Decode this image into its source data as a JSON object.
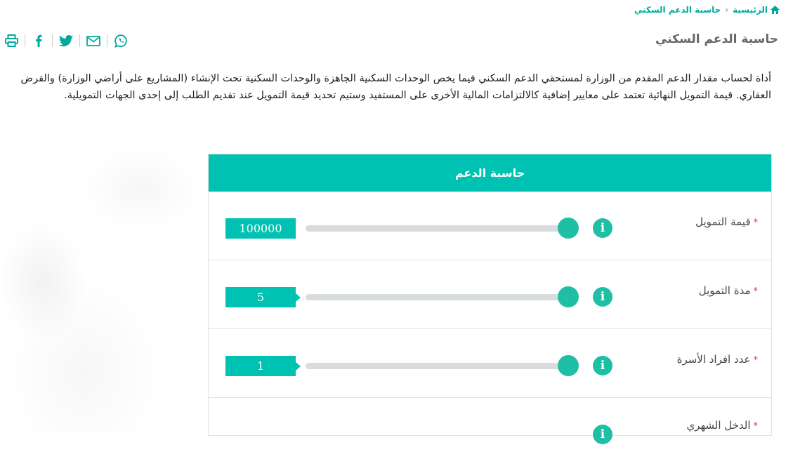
{
  "breadcrumb": {
    "home": "الرئيسية",
    "separator": "›",
    "current": "حاسبة الدعم السكني"
  },
  "page_title": "حاسبة الدعم السكني",
  "share_icons": [
    "whatsapp-icon",
    "email-icon",
    "twitter-icon",
    "facebook-icon",
    "print-icon"
  ],
  "description": "أداة لحساب مقدار الدعم المقدم من الوزارة لمستحقي الدعم السكني فيما يخص الوحدات السكنية الجاهزة والوحدات السكنية تحت الإنشاء (المشاريع على أراضي الوزارة) والقرض العقاري. قيمة التمويل النهائية تعتمد على معايير إضافية كالالتزامات المالية الأخرى على المستفيد وستيم تحديد قيمة التمويل عند تقديم الطلب إلى إحدى الجهات التمويلية.",
  "calculator": {
    "title": "حاسبة الدعم",
    "required_mark": "*",
    "fields": [
      {
        "label": "قيمة التمويل",
        "value": "100000",
        "level": 1.0
      },
      {
        "label": "مدة التمويل",
        "value": "5",
        "level": 1.0
      },
      {
        "label": "عدد افراد الأسرة",
        "value": "1",
        "level": 1.0
      },
      {
        "label": "الدخل الشهري",
        "value": "",
        "level": 1.0
      }
    ]
  },
  "colors": {
    "accent": "#00c2b2",
    "slider": "#1fbfa5",
    "link": "#00a99d",
    "required": "#e53935"
  }
}
